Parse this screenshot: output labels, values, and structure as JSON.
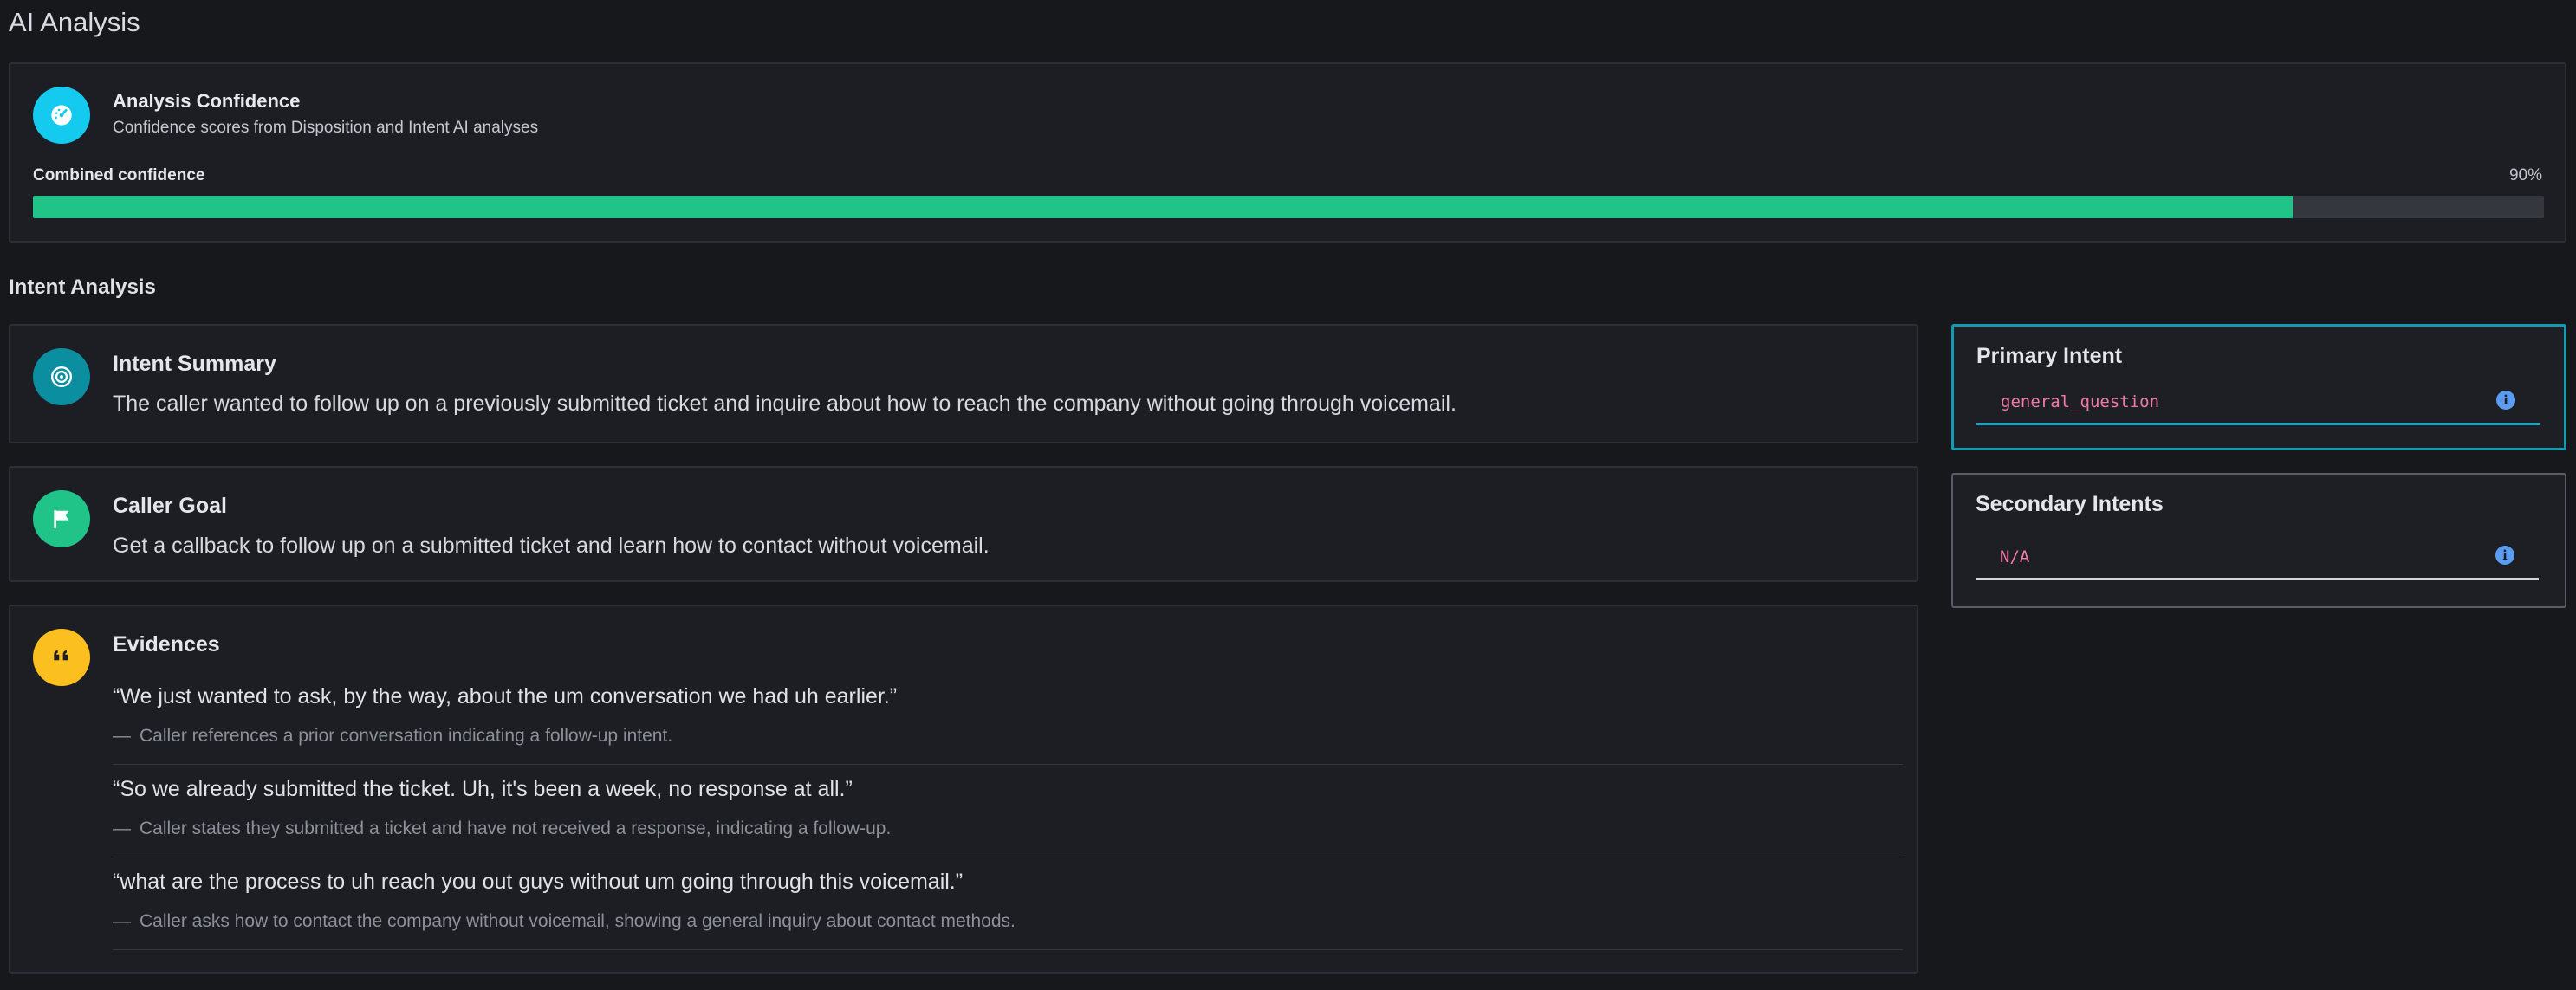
{
  "page": {
    "title": "AI Analysis"
  },
  "confidence": {
    "icon": "gauge-icon",
    "title": "Analysis Confidence",
    "subtitle": "Confidence scores from Disposition and Intent AI analyses",
    "label": "Combined confidence",
    "percent_text": "90%",
    "value": 0.9,
    "colors": {
      "icon_bg": "#14cbef",
      "bar_fill": "#20c488",
      "bar_track": "#34373d"
    }
  },
  "intent_analysis": {
    "title": "Intent Analysis",
    "summary": {
      "icon": "target-icon",
      "title": "Intent Summary",
      "text": "The caller wanted to follow up on a previously submitted ticket and inquire about how to reach the company without going through voicemail."
    },
    "goal": {
      "icon": "flag-icon",
      "title": "Caller Goal",
      "text": "Get a callback to follow up on a submitted ticket and learn how to contact without voicemail."
    },
    "evidences": {
      "icon": "quote-icon",
      "title": "Evidences",
      "dash": "—",
      "items": [
        {
          "quote": "“We just wanted to ask, by the way, about the um conversation we had uh earlier.”",
          "note": "Caller references a prior conversation indicating a follow-up intent."
        },
        {
          "quote": "“So we already submitted the ticket. Uh, it's been a week, no response at all.”",
          "note": "Caller states they submitted a ticket and have not received a response, indicating a follow-up."
        },
        {
          "quote": "“what are the process to uh reach you out guys without um going through this voicemail.”",
          "note": "Caller asks how to contact the company without voicemail, showing a general inquiry about contact methods."
        }
      ]
    }
  },
  "primary_intent": {
    "title": "Primary Intent",
    "value": "general_question",
    "info_icon": "info-icon",
    "info_glyph": "i"
  },
  "secondary_intents": {
    "title": "Secondary Intents",
    "value": "N/A",
    "info_icon": "info-icon",
    "info_glyph": "i"
  }
}
